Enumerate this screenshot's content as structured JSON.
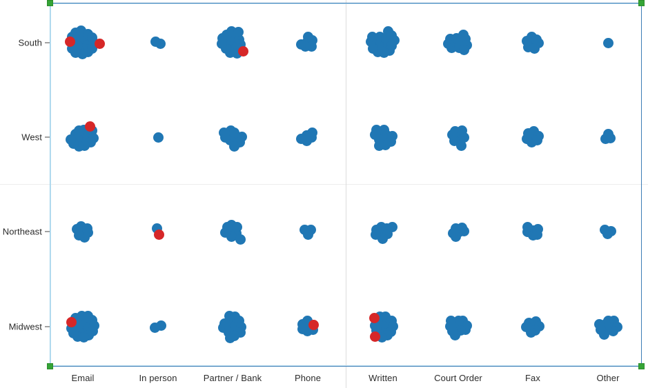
{
  "chart_data": {
    "type": "scatter",
    "title": "",
    "subtitle": "",
    "xlabel": "",
    "ylabel": "",
    "plot_style": "categorical dot / swarm plot",
    "grid": true,
    "legend_position": "none",
    "marker": {
      "shape": "circle",
      "radius_px": 7.5,
      "colors": {
        "primary": "#2077b4",
        "highlight": "#d62728"
      },
      "color_meaning": {
        "#2077b4": "standard point",
        "#d62728": "highlighted point"
      }
    },
    "categories": [
      "Email",
      "In person",
      "Partner / Bank",
      "Phone",
      "Written",
      "Court Order",
      "Fax",
      "Other"
    ],
    "y_categories": [
      "South",
      "West",
      "Northeast",
      "Midwest"
    ],
    "y_category_order_top_to_bottom": [
      "South",
      "West",
      "Northeast",
      "Midwest"
    ],
    "panel_split": {
      "vertical_divider_after_category": "Phone",
      "horizontal_divider_after_row": "West"
    },
    "cells": [
      {
        "row": "South",
        "category": "Email",
        "count": 20,
        "blue": 18,
        "red": 2
      },
      {
        "row": "South",
        "category": "In person",
        "count": 2,
        "blue": 2,
        "red": 0
      },
      {
        "row": "South",
        "category": "Partner / Bank",
        "count": 16,
        "blue": 15,
        "red": 1
      },
      {
        "row": "South",
        "category": "Phone",
        "count": 6,
        "blue": 6,
        "red": 0
      },
      {
        "row": "South",
        "category": "Written",
        "count": 17,
        "blue": 17,
        "red": 0
      },
      {
        "row": "South",
        "category": "Court Order",
        "count": 11,
        "blue": 11,
        "red": 0
      },
      {
        "row": "South",
        "category": "Fax",
        "count": 7,
        "blue": 7,
        "red": 0
      },
      {
        "row": "South",
        "category": "Other",
        "count": 1,
        "blue": 1,
        "red": 0
      },
      {
        "row": "West",
        "category": "Email",
        "count": 15,
        "blue": 14,
        "red": 1
      },
      {
        "row": "West",
        "category": "In person",
        "count": 1,
        "blue": 1,
        "red": 0
      },
      {
        "row": "West",
        "category": "Partner / Bank",
        "count": 10,
        "blue": 10,
        "red": 0
      },
      {
        "row": "West",
        "category": "Phone",
        "count": 5,
        "blue": 5,
        "red": 0
      },
      {
        "row": "West",
        "category": "Written",
        "count": 11,
        "blue": 11,
        "red": 0
      },
      {
        "row": "West",
        "category": "Court Order",
        "count": 8,
        "blue": 8,
        "red": 0
      },
      {
        "row": "West",
        "category": "Fax",
        "count": 7,
        "blue": 7,
        "red": 0
      },
      {
        "row": "West",
        "category": "Other",
        "count": 3,
        "blue": 3,
        "red": 0
      },
      {
        "row": "Northeast",
        "category": "Email",
        "count": 7,
        "blue": 7,
        "red": 0
      },
      {
        "row": "Northeast",
        "category": "In person",
        "count": 2,
        "blue": 1,
        "red": 1
      },
      {
        "row": "Northeast",
        "category": "Partner / Bank",
        "count": 8,
        "blue": 8,
        "red": 0
      },
      {
        "row": "Northeast",
        "category": "Phone",
        "count": 3,
        "blue": 3,
        "red": 0
      },
      {
        "row": "Northeast",
        "category": "Written",
        "count": 8,
        "blue": 8,
        "red": 0
      },
      {
        "row": "Northeast",
        "category": "Court Order",
        "count": 6,
        "blue": 6,
        "red": 0
      },
      {
        "row": "Northeast",
        "category": "Fax",
        "count": 6,
        "blue": 6,
        "red": 0
      },
      {
        "row": "Northeast",
        "category": "Other",
        "count": 3,
        "blue": 3,
        "red": 0
      },
      {
        "row": "Midwest",
        "category": "Email",
        "count": 19,
        "blue": 18,
        "red": 1
      },
      {
        "row": "Midwest",
        "category": "In person",
        "count": 2,
        "blue": 2,
        "red": 0
      },
      {
        "row": "Midwest",
        "category": "Partner / Bank",
        "count": 14,
        "blue": 14,
        "red": 0
      },
      {
        "row": "Midwest",
        "category": "Phone",
        "count": 7,
        "blue": 6,
        "red": 1
      },
      {
        "row": "Midwest",
        "category": "Written",
        "count": 16,
        "blue": 14,
        "red": 2
      },
      {
        "row": "Midwest",
        "category": "Court Order",
        "count": 11,
        "blue": 11,
        "red": 0
      },
      {
        "row": "Midwest",
        "category": "Fax",
        "count": 7,
        "blue": 7,
        "red": 0
      },
      {
        "row": "Midwest",
        "category": "Other",
        "count": 10,
        "blue": 10,
        "red": 0
      }
    ]
  },
  "selection": {
    "visible": true,
    "border_color": "#3b7cb5",
    "handle_color": "#35a436",
    "handle_count": 4
  },
  "axes": {
    "x_axis_color": "#3b7cb5",
    "y_axis_color": "#9ed2ea",
    "tick_color": "#444444",
    "divider_color": "#ececec"
  }
}
